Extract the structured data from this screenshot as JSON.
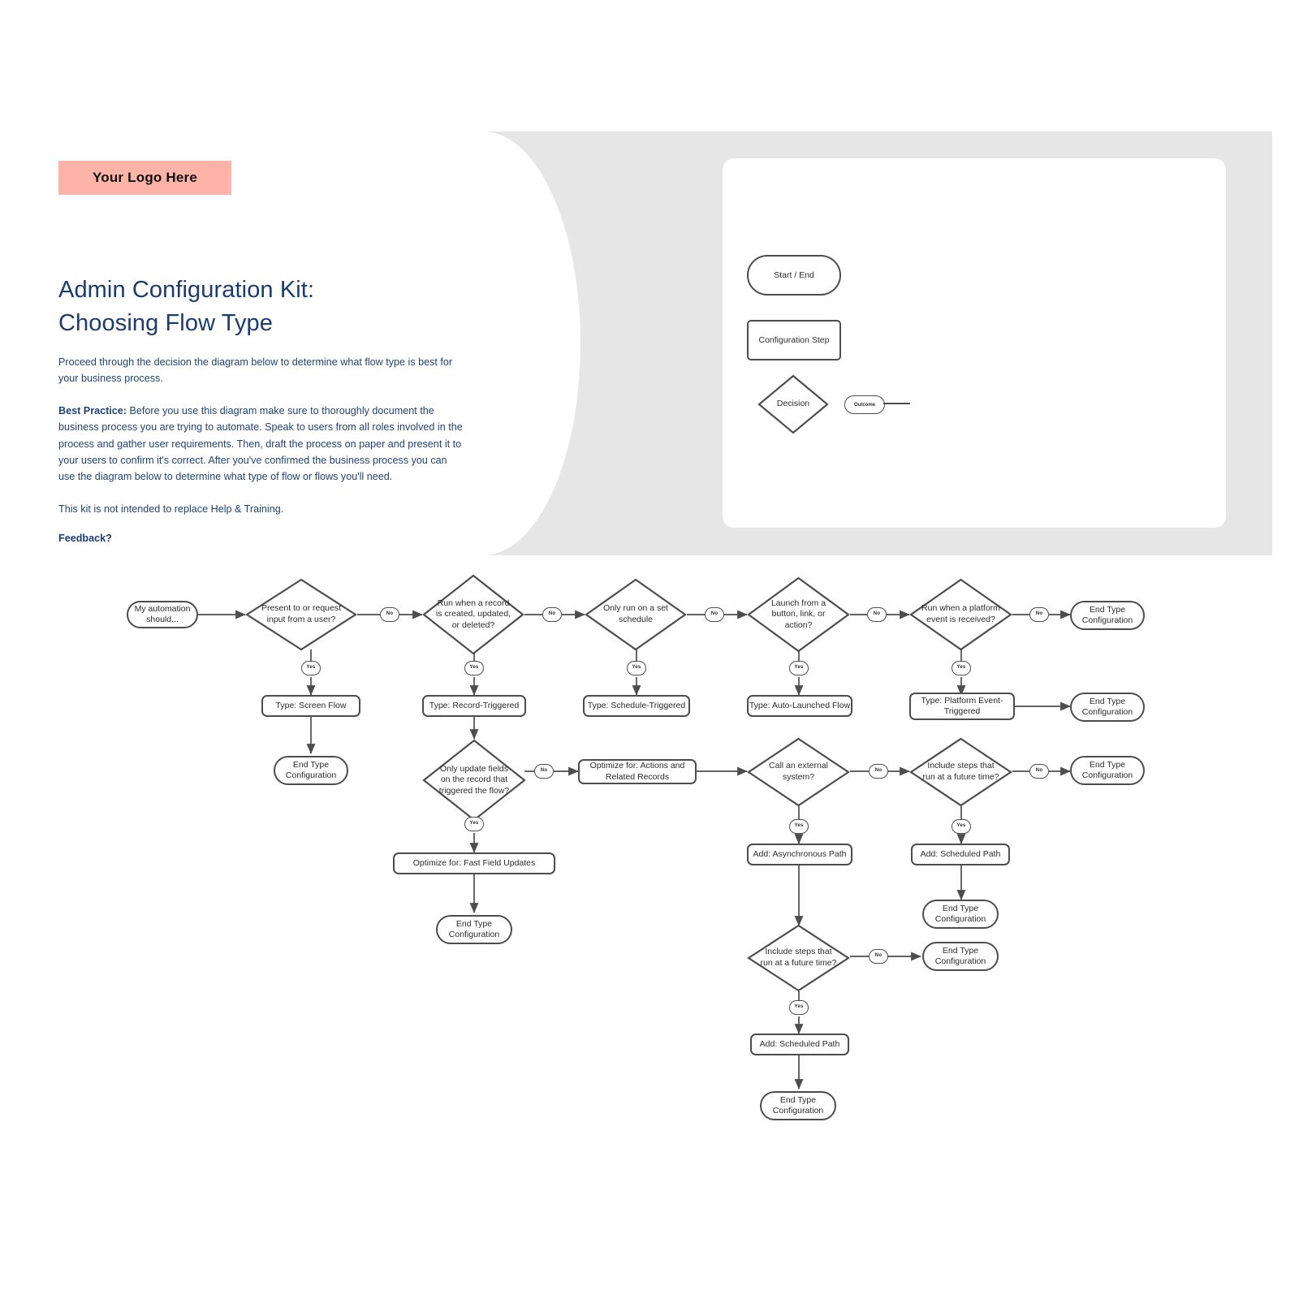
{
  "logo": {
    "text": "Your Logo Here",
    "bg": "#fdb3a7"
  },
  "header": {
    "title_line1": "Admin Configuration Kit:",
    "title_line2": "Choosing Flow Type",
    "intro": "Proceed through the decision the diagram below to determine what flow type is best for your business process.",
    "best_practice_label": "Best Practice:",
    "best_practice_body": " Before you use this diagram make sure to thoroughly document the business process you are trying to automate. Speak to users from all roles involved in the process and gather user requirements. Then, draft the process on paper and present it to your users to confirm it's correct. After you've confirmed the business process you can use the diagram below to determine what type of flow or flows  you'll need.",
    "disclaimer": "This kit is not intended to replace Help & Training.",
    "feedback": "Feedback?",
    "title_color": "#1b3c6e"
  },
  "legend": {
    "terminator": "Start / End",
    "process": "Configuration Step",
    "decision": "Decision",
    "outcome": "Outcome"
  },
  "flow": {
    "start": "My automation should...",
    "d1": "Present to or request input from a user?",
    "d2": "Run when a record is created, updated, or deleted?",
    "d3": "Only run on a set schedule",
    "d4": "Launch from a button, link, or action?",
    "d5": "Run when a platform event is received?",
    "d6": "Only update fields on the record that triggered the flow?",
    "d7": "Call an external system?",
    "d8": "Include  steps that run at a future time?",
    "d9": "Include  steps that run at a future time?",
    "t1": "Type: Screen Flow",
    "t2": "Type: Record-Triggered",
    "t3": "Type: Schedule-Triggered",
    "t4": "Type: Auto-Launched Flow",
    "t5": "Type: Platform Event-Triggered",
    "p1": "Optimize for: Actions and Related Records",
    "p2": "Optimize for: Fast Field Updates",
    "p3": "Add: Asynchronous Path",
    "p4": "Add: Scheduled Path",
    "p5": "Add: Scheduled Path",
    "end1": "End Type Configuration",
    "end2": "End Type Configuration",
    "end3": "End Type Configuration",
    "end4": "End Type Configuration",
    "end5": "End Type Configuration",
    "end6": "End Type Configuration",
    "end7": "End Type Configuration",
    "end8": "End Type Configuration",
    "yes": "Yes",
    "no": "No"
  },
  "edge_labels": {
    "no1": "No",
    "no2": "No",
    "no3": "No",
    "no4": "No",
    "no5": "No",
    "no6": "No",
    "no7": "No",
    "no8": "No",
    "no9": "No",
    "yes1": "Yes",
    "yes2": "Yes",
    "yes3": "Yes",
    "yes4": "Yes",
    "yes5": "Yes",
    "yes6": "Yes",
    "yes7": "Yes",
    "yes8": "Yes",
    "yes9": "Yes"
  }
}
